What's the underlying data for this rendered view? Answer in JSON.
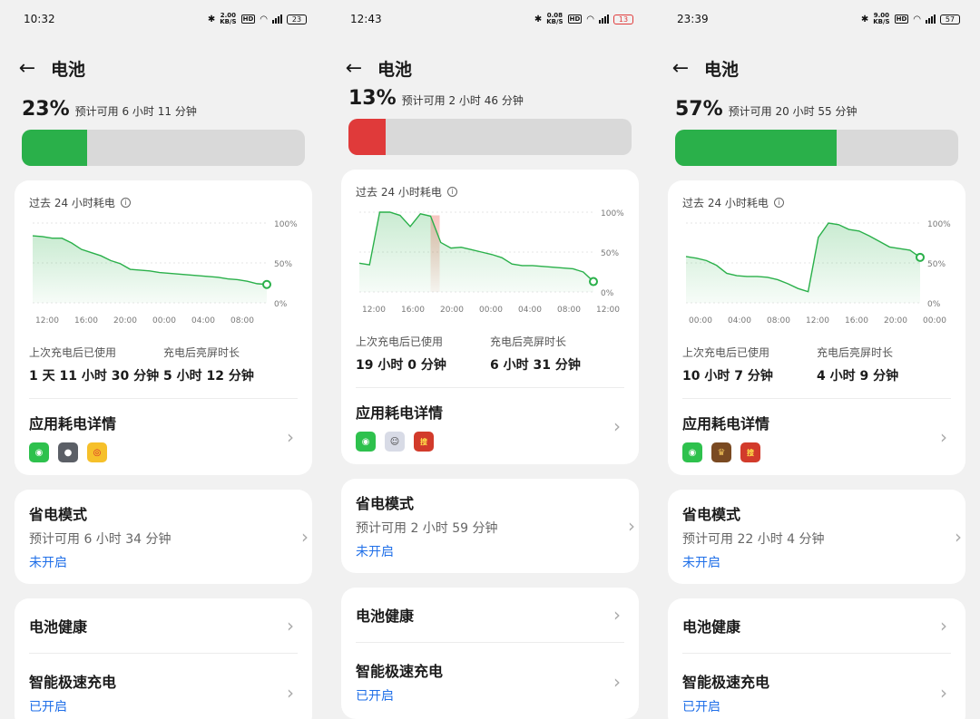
{
  "screens": [
    {
      "status": {
        "time": "10:32",
        "net_speed": "2.00\nKB/S",
        "battery": "23",
        "battery_low": false
      },
      "header": {
        "title": "电池"
      },
      "summary": {
        "percent": "23%",
        "estimate": "预计可用 6 小时 11 分钟",
        "level": 0.23,
        "color": "#2ab04a"
      },
      "usage": {
        "title": "过去 24 小时耗电",
        "x_ticks": [
          "12:00",
          "16:00",
          "20:00",
          "00:00",
          "04:00",
          "08:00"
        ],
        "y_ticks": [
          "100%",
          "50%",
          "0%"
        ],
        "stats": [
          {
            "label": "上次充电后已使用",
            "value": "1 天 11 小时 30 分钟"
          },
          {
            "label": "充电后亮屏时长",
            "value": "5 小时 12 分钟"
          }
        ],
        "apps_title": "应用耗电详情",
        "apps": [
          "wechat-icon",
          "camera-icon",
          "weibo-icon"
        ]
      },
      "power_saving": {
        "title": "省电模式",
        "estimate": "预计可用 6 小时 34 分钟",
        "state": "未开启"
      },
      "health": {
        "title": "电池健康"
      },
      "fast_charge": {
        "title": "智能极速充电",
        "state": "已开启"
      }
    },
    {
      "status": {
        "time": "12:43",
        "net_speed": "0.08\nKB/S",
        "battery": "13",
        "battery_low": true
      },
      "header": {
        "title": "电池"
      },
      "summary": {
        "percent": "13%",
        "estimate": "预计可用 2 小时 46 分钟",
        "level": 0.13,
        "color": "#e03a3a"
      },
      "usage": {
        "title": "过去 24 小时耗电",
        "x_ticks": [
          "12:00",
          "16:00",
          "20:00",
          "00:00",
          "04:00",
          "08:00",
          "12:00"
        ],
        "y_ticks": [
          "100%",
          "50%",
          "0%"
        ],
        "stats": [
          {
            "label": "上次充电后已使用",
            "value": "19 小时 0 分钟"
          },
          {
            "label": "充电后亮屏时长",
            "value": "6 小时 31 分钟"
          }
        ],
        "apps_title": "应用耗电详情",
        "apps": [
          "wechat-icon",
          "anime-game-icon",
          "sogou-game-icon"
        ]
      },
      "power_saving": {
        "title": "省电模式",
        "estimate": "预计可用 2 小时 59 分钟",
        "state": "未开启"
      },
      "health": {
        "title": "电池健康"
      },
      "fast_charge": {
        "title": "智能极速充电",
        "state": "已开启"
      }
    },
    {
      "status": {
        "time": "23:39",
        "net_speed": "9.00\nKB/S",
        "battery": "57",
        "battery_low": false
      },
      "header": {
        "title": "电池"
      },
      "summary": {
        "percent": "57%",
        "estimate": "预计可用 20 小时 55 分钟",
        "level": 0.57,
        "color": "#2ab04a"
      },
      "usage": {
        "title": "过去 24 小时耗电",
        "x_ticks": [
          "00:00",
          "04:00",
          "08:00",
          "12:00",
          "16:00",
          "20:00",
          "00:00"
        ],
        "y_ticks": [
          "100%",
          "50%",
          "0%"
        ],
        "stats": [
          {
            "label": "上次充电后已使用",
            "value": "10 小时 7 分钟"
          },
          {
            "label": "充电后亮屏时长",
            "value": "4 小时 9 分钟"
          }
        ],
        "apps_title": "应用耗电详情",
        "apps": [
          "wechat-icon",
          "hero-game-icon",
          "sogou-game-icon"
        ]
      },
      "power_saving": {
        "title": "省电模式",
        "estimate": "预计可用 22 小时 4 分钟",
        "state": "未开启"
      },
      "health": {
        "title": "电池健康"
      },
      "fast_charge": {
        "title": "智能极速充电",
        "state": "已开启"
      }
    }
  ],
  "chart_data": [
    {
      "type": "area",
      "title": "过去 24 小时耗电",
      "x_ticks": [
        "12:00",
        "16:00",
        "20:00",
        "00:00",
        "04:00",
        "08:00"
      ],
      "ylim": [
        0,
        100
      ],
      "y_ticks": [
        "100%",
        "50%",
        "0%"
      ],
      "series": [
        {
          "values": [
            84,
            83,
            81,
            81,
            75,
            67,
            63,
            59,
            53,
            49,
            42,
            41,
            40,
            38,
            37,
            36,
            35,
            34,
            33,
            32,
            30,
            29,
            27,
            24,
            23
          ]
        }
      ],
      "color": "#2ab04a"
    },
    {
      "type": "area",
      "title": "过去 24 小时耗电",
      "x_ticks": [
        "12:00",
        "16:00",
        "20:00",
        "00:00",
        "04:00",
        "08:00",
        "12:00"
      ],
      "ylim": [
        0,
        100
      ],
      "y_ticks": [
        "100%",
        "50%",
        "0%"
      ],
      "series": [
        {
          "values": [
            36,
            34,
            100,
            100,
            96,
            82,
            98,
            95,
            62,
            55,
            56,
            53,
            50,
            47,
            43,
            35,
            33,
            33,
            32,
            31,
            30,
            29,
            25,
            13
          ]
        }
      ],
      "highlight_range": [
        20,
        23
      ],
      "color": "#2ab04a"
    },
    {
      "type": "area",
      "title": "过去 24 小时耗电",
      "x_ticks": [
        "00:00",
        "04:00",
        "08:00",
        "12:00",
        "16:00",
        "20:00",
        "00:00"
      ],
      "ylim": [
        0,
        100
      ],
      "y_ticks": [
        "100%",
        "50%",
        "0%"
      ],
      "series": [
        {
          "values": [
            58,
            56,
            53,
            47,
            37,
            34,
            33,
            33,
            32,
            29,
            24,
            18,
            14,
            82,
            100,
            98,
            92,
            90,
            84,
            77,
            70,
            68,
            66,
            57
          ]
        }
      ],
      "color": "#2ab04a"
    }
  ]
}
